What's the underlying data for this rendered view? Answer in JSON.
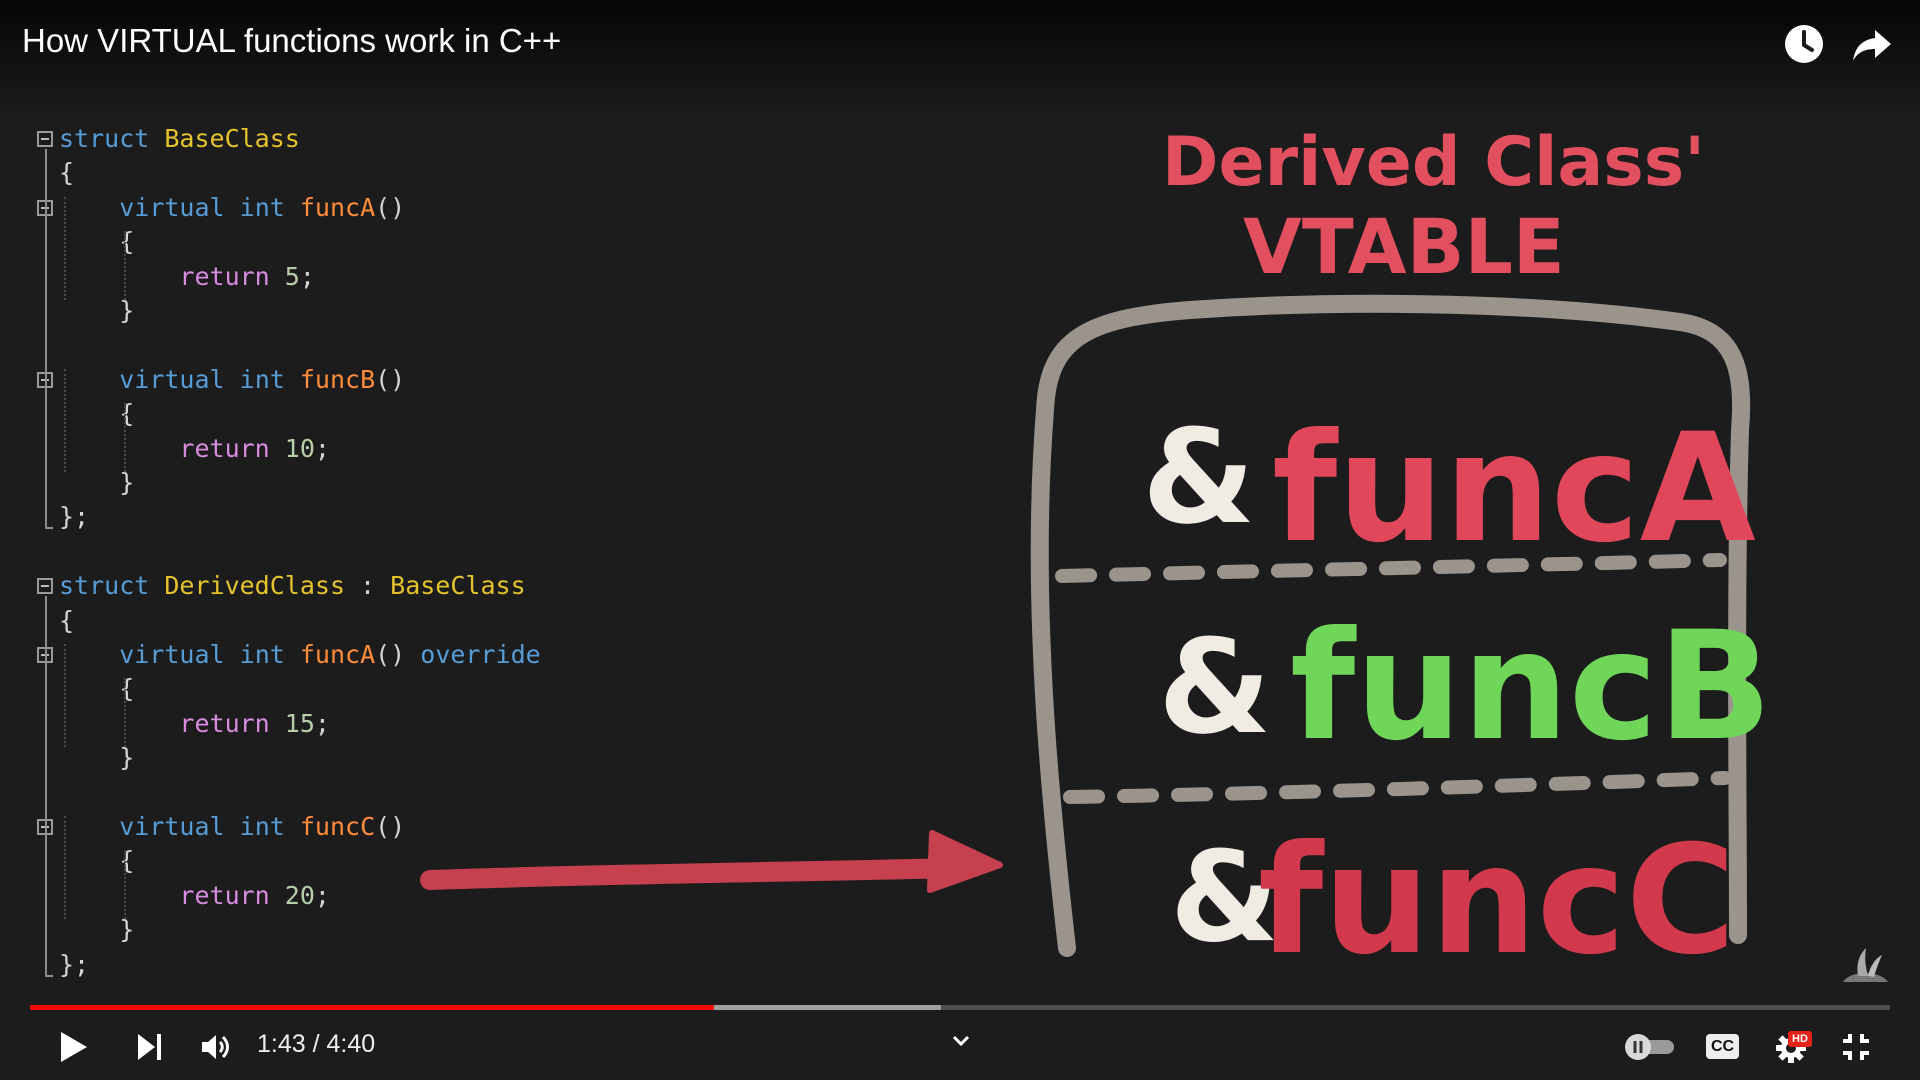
{
  "video": {
    "title": "How VIRTUAL functions work in C++"
  },
  "top_actions": [
    {
      "name": "watch-later",
      "icon": "clock-icon"
    },
    {
      "name": "share",
      "icon": "share-arrow-icon"
    }
  ],
  "code_lines": [
    {
      "text_parts": [
        [
          "kw",
          "struct"
        ],
        [
          "punc",
          " "
        ],
        [
          "ty",
          "BaseClass"
        ]
      ]
    },
    {
      "text_parts": [
        [
          "punc",
          "{"
        ]
      ]
    },
    {
      "text_parts": [
        [
          "punc",
          "    "
        ],
        [
          "kw",
          "virtual"
        ],
        [
          "punc",
          " "
        ],
        [
          "kw",
          "int"
        ],
        [
          "punc",
          " "
        ],
        [
          "fn",
          "funcA"
        ],
        [
          "punc",
          "()"
        ]
      ]
    },
    {
      "text_parts": [
        [
          "punc",
          "    {"
        ]
      ]
    },
    {
      "text_parts": [
        [
          "punc",
          "        "
        ],
        [
          "ret",
          "return"
        ],
        [
          "punc",
          " "
        ],
        [
          "num",
          "5"
        ],
        [
          "punc",
          ";"
        ]
      ]
    },
    {
      "text_parts": [
        [
          "punc",
          "    }"
        ]
      ]
    },
    {
      "text_parts": [
        [
          "punc",
          ""
        ]
      ]
    },
    {
      "text_parts": [
        [
          "punc",
          "    "
        ],
        [
          "kw",
          "virtual"
        ],
        [
          "punc",
          " "
        ],
        [
          "kw",
          "int"
        ],
        [
          "punc",
          " "
        ],
        [
          "fn",
          "funcB"
        ],
        [
          "punc",
          "()"
        ]
      ]
    },
    {
      "text_parts": [
        [
          "punc",
          "    {"
        ]
      ]
    },
    {
      "text_parts": [
        [
          "punc",
          "        "
        ],
        [
          "ret",
          "return"
        ],
        [
          "punc",
          " "
        ],
        [
          "num",
          "10"
        ],
        [
          "punc",
          ";"
        ]
      ]
    },
    {
      "text_parts": [
        [
          "punc",
          "    }"
        ]
      ]
    },
    {
      "text_parts": [
        [
          "punc",
          "};"
        ]
      ]
    },
    {
      "text_parts": [
        [
          "punc",
          ""
        ]
      ]
    },
    {
      "text_parts": [
        [
          "kw",
          "struct"
        ],
        [
          "punc",
          " "
        ],
        [
          "ty",
          "DerivedClass"
        ],
        [
          "punc",
          " : "
        ],
        [
          "ty",
          "BaseClass"
        ]
      ]
    },
    {
      "text_parts": [
        [
          "punc",
          "{"
        ]
      ]
    },
    {
      "text_parts": [
        [
          "punc",
          "    "
        ],
        [
          "kw",
          "virtual"
        ],
        [
          "punc",
          " "
        ],
        [
          "kw",
          "int"
        ],
        [
          "punc",
          " "
        ],
        [
          "fn",
          "funcA"
        ],
        [
          "punc",
          "() "
        ],
        [
          "kw",
          "override"
        ]
      ]
    },
    {
      "text_parts": [
        [
          "punc",
          "    {"
        ]
      ]
    },
    {
      "text_parts": [
        [
          "punc",
          "        "
        ],
        [
          "ret",
          "return"
        ],
        [
          "punc",
          " "
        ],
        [
          "num",
          "15"
        ],
        [
          "punc",
          ";"
        ]
      ]
    },
    {
      "text_parts": [
        [
          "punc",
          "    }"
        ]
      ]
    },
    {
      "text_parts": [
        [
          "punc",
          ""
        ]
      ]
    },
    {
      "text_parts": [
        [
          "punc",
          "    "
        ],
        [
          "kw",
          "virtual"
        ],
        [
          "punc",
          " "
        ],
        [
          "kw",
          "int"
        ],
        [
          "punc",
          " "
        ],
        [
          "fn",
          "funcC"
        ],
        [
          "punc",
          "()"
        ]
      ]
    },
    {
      "text_parts": [
        [
          "punc",
          "    {"
        ]
      ]
    },
    {
      "text_parts": [
        [
          "punc",
          "        "
        ],
        [
          "ret",
          "return"
        ],
        [
          "punc",
          " "
        ],
        [
          "num",
          "20"
        ],
        [
          "punc",
          ";"
        ]
      ]
    },
    {
      "text_parts": [
        [
          "punc",
          "    }"
        ]
      ]
    },
    {
      "text_parts": [
        [
          "punc",
          "};"
        ]
      ]
    }
  ],
  "vtable": {
    "heading_line1": "Derived Class'",
    "heading_line2": "VTABLE",
    "entries": [
      {
        "amp": "&",
        "func": "funcA",
        "color": "#e0475a"
      },
      {
        "amp": "&",
        "func": "funcB",
        "color": "#6fd65a"
      },
      {
        "amp": "&",
        "func": "funcC",
        "color": "#d2394c"
      }
    ],
    "heading_color": "#e24f5f",
    "box_color": "#9a948d",
    "arrow_color": "#c7404f"
  },
  "player": {
    "current_time": "1:43",
    "duration": "4:40",
    "time_display": "1:43 / 4:40",
    "played_fraction": 0.368,
    "buffered_fraction": 0.49,
    "cc_label": "CC",
    "hd_label": "HD",
    "controls": [
      "play-icon",
      "next-icon",
      "volume-icon",
      "chevron-down-icon",
      "autoplay-toggle",
      "cc-icon",
      "settings-icon",
      "exit-fullscreen-icon"
    ]
  },
  "colors": {
    "progress": "#ff0000",
    "accent": "#e62117"
  }
}
